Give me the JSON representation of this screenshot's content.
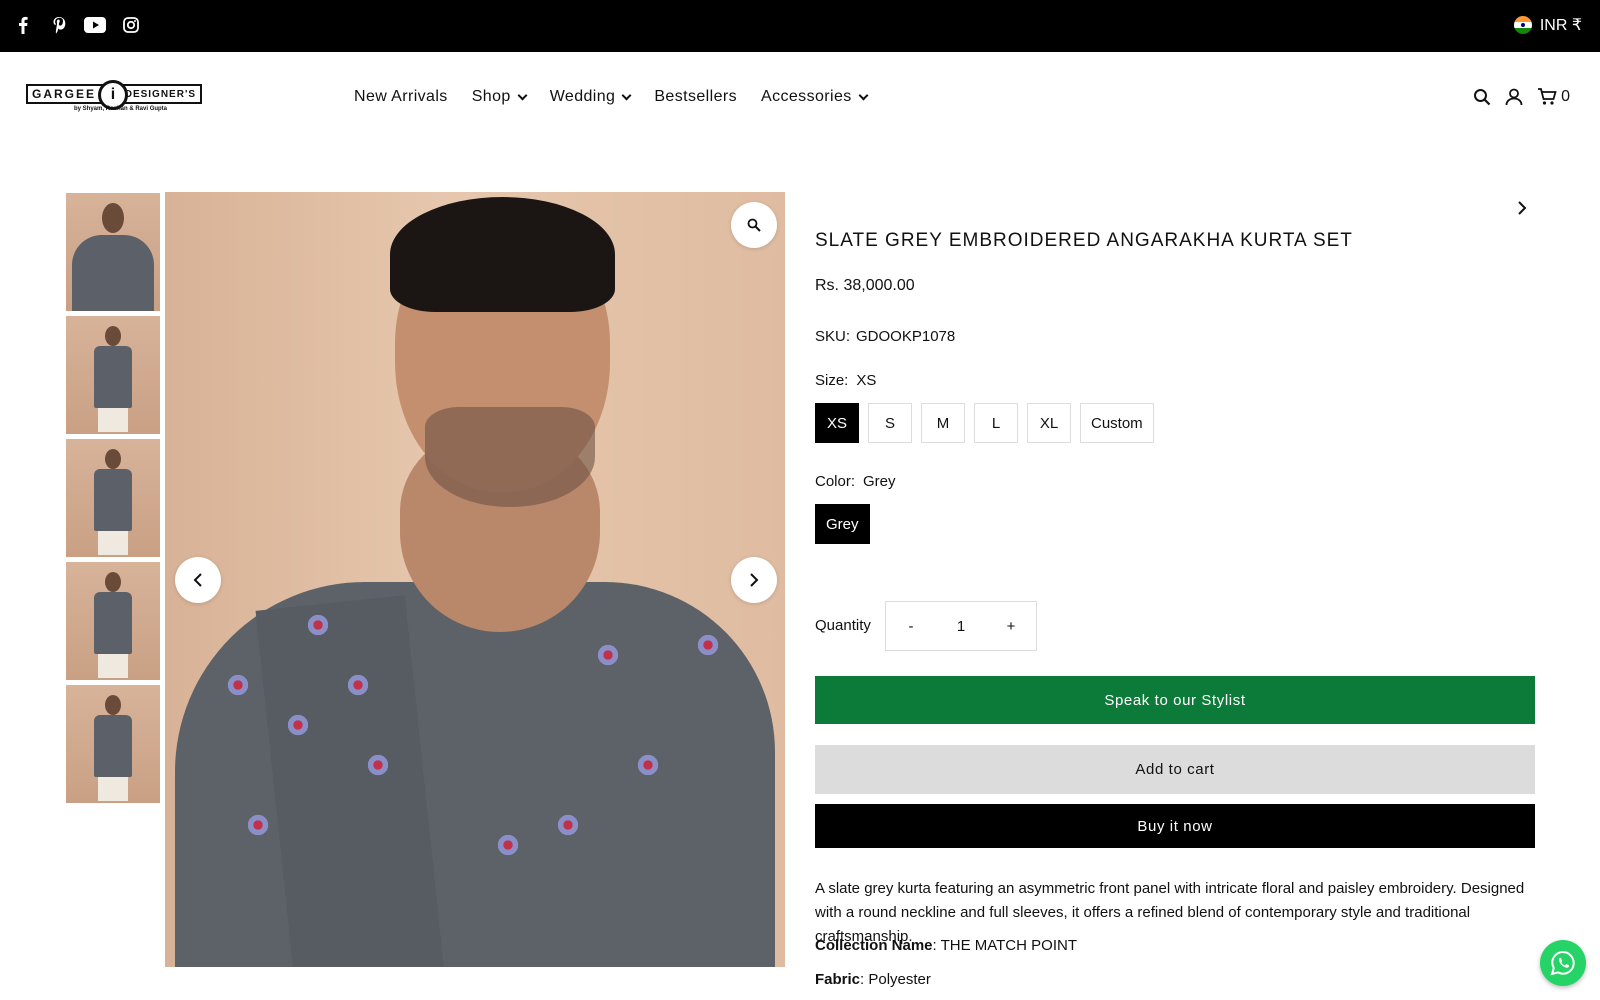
{
  "topbar": {
    "social_icons": [
      "facebook-icon",
      "pinterest-icon",
      "youtube-icon",
      "instagram-icon"
    ],
    "currency": "INR ₹"
  },
  "header": {
    "logo_text": {
      "left": "GARGEE",
      "right": "DESIGNER'S",
      "tagline": "by Shyam, Roshan & Ravi Gupta"
    },
    "nav": [
      {
        "label": "New Arrivals",
        "dropdown": false
      },
      {
        "label": "Shop",
        "dropdown": true
      },
      {
        "label": "Wedding",
        "dropdown": true
      },
      {
        "label": "Bestsellers",
        "dropdown": false
      },
      {
        "label": "Accessories",
        "dropdown": true
      }
    ],
    "cart_count": "0"
  },
  "gallery": {
    "thumbnail_count": 5,
    "zoom_icon": "magnifier-icon"
  },
  "product": {
    "title": "SLATE GREY EMBROIDERED ANGARAKHA KURTA SET",
    "price": "Rs. 38,000.00",
    "sku_label": "SKU:",
    "sku_value": "GDOOKP1078",
    "size_label": "Size:",
    "size_selected": "XS",
    "sizes": [
      "XS",
      "S",
      "M",
      "L",
      "XL",
      "Custom"
    ],
    "color_label": "Color:",
    "color_selected": "Grey",
    "colors": [
      "Grey"
    ],
    "quantity_label": "Quantity",
    "quantity_minus": "-",
    "quantity_value": "1",
    "quantity_plus": "+",
    "stylist_button": "Speak to our Stylist",
    "add_to_cart": "Add to cart",
    "buy_now": "Buy it now",
    "description": "A slate grey kurta featuring an asymmetric front panel with intricate floral and paisley embroidery. Designed with a round neckline and full sleeves, it offers a refined blend of contemporary style and traditional craftsmanship.",
    "collection_label": "Collection Name",
    "collection_value": ": THE MATCH POINT",
    "fabric_label": "Fabric",
    "fabric_value": ": Polyester"
  },
  "colors": {
    "topbar_bg": "#000000",
    "stylist_green": "#0c7a39",
    "cart_grey": "#dcdcdc",
    "buy_black": "#000000",
    "whatsapp_green": "#25d366"
  }
}
